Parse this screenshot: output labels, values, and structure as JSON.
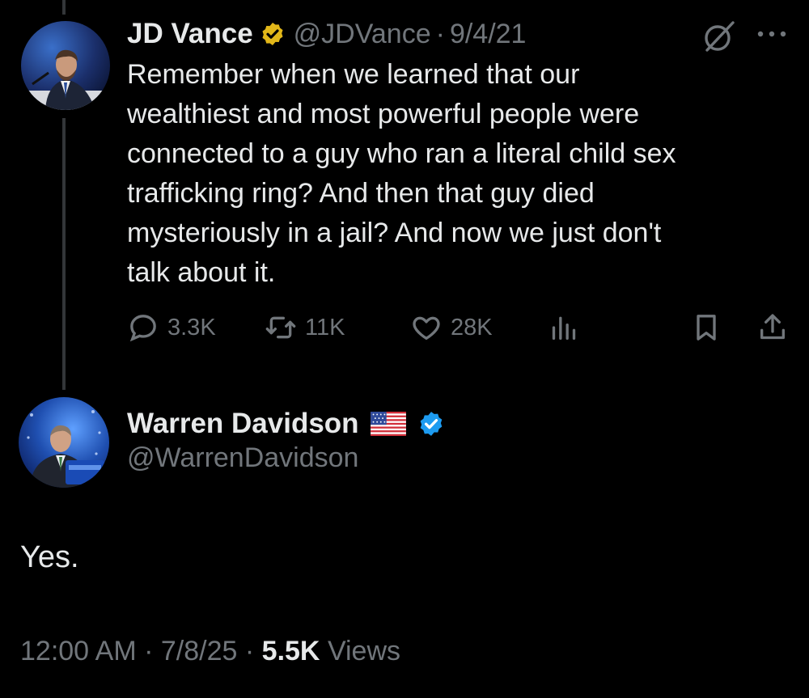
{
  "tweet": {
    "author_name": "JD Vance",
    "author_handle": "@JDVance",
    "separator": "·",
    "date": "9/4/21",
    "text": "Remember when we learned that our\nwealthiest and most powerful people were\nconnected to a guy who ran a literal child sex\ntrafficking ring? And then that guy died\nmysteriously in a jail? And now we just don't\ntalk about it.",
    "replies": "3.3K",
    "reposts": "11K",
    "likes": "28K"
  },
  "reply": {
    "author_name": "Warren Davidson",
    "author_handle": "@WarrenDavidson",
    "text": "Yes.",
    "time": "12:00 AM",
    "date": "7/8/25",
    "separator": "·",
    "views_count": "5.5K",
    "views_label": "Views"
  },
  "colors": {
    "background": "#000000",
    "primary_text": "#e7e9ea",
    "secondary_text": "#71767b",
    "verified_gold": "#e2b719",
    "verified_blue": "#1d9bf0",
    "thread_line": "#333639"
  },
  "icons": {
    "reply": "reply-icon",
    "repost": "repost-icon",
    "like": "heart-icon",
    "views": "views-icon",
    "bookmark": "bookmark-icon",
    "share": "share-icon",
    "grok": "grok-icon",
    "more": "more-icon",
    "verified": "verified-badge-icon",
    "flag": "us-flag-icon"
  }
}
